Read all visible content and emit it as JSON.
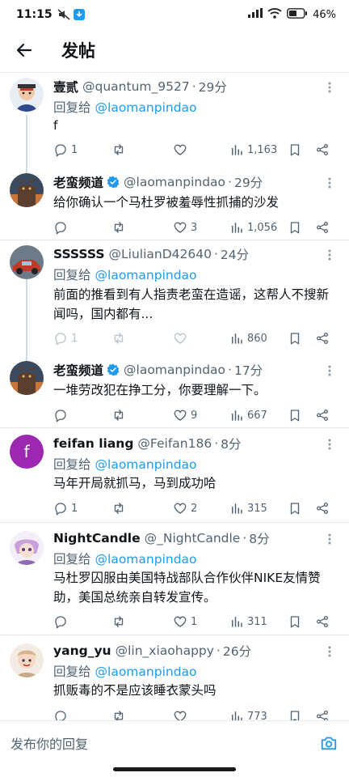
{
  "status_bar": {
    "time": "11:15",
    "battery": "46%"
  },
  "header": {
    "title": "发帖"
  },
  "posts": [
    {
      "name": "壹贰",
      "handle": "@quantum_9527",
      "time": "29分",
      "reply_prefix": "回复给",
      "reply_to": "@laomanpindao",
      "text": "f",
      "replies": "1",
      "retweets": "",
      "likes": "",
      "views": "1,163",
      "avatar_color": "#c9d6e8"
    },
    {
      "name": "老蛮频道",
      "verified": true,
      "handle": "@laomanpindao",
      "time": "29分",
      "text": "给你确认一个马杜罗被羞辱性抓捕的沙发",
      "replies": "",
      "retweets": "",
      "likes": "3",
      "views": "1,056",
      "avatar_color": "#7a5b48"
    },
    {
      "name": "SSSSSS",
      "handle": "@LiulianD42640",
      "time": "24分",
      "reply_prefix": "回复给",
      "reply_to": "@laomanpindao",
      "text": "前面的推看到有人指责老蛮在造谣，这帮人不搜新闻吗，国内都有...",
      "replies": "1",
      "retweets": "",
      "likes": "",
      "views": "860",
      "avatar_color": "#9aa8b4"
    },
    {
      "name": "老蛮频道",
      "verified": true,
      "handle": "@laomanpindao",
      "time": "17分",
      "text": "一堆劳改犯在挣工分，你要理解一下。",
      "replies": "",
      "retweets": "",
      "likes": "9",
      "views": "667",
      "avatar_color": "#7a5b48"
    },
    {
      "name": "feifan liang",
      "handle": "@Feifan186",
      "time": "8分",
      "reply_prefix": "回复给",
      "reply_to": "@laomanpindao",
      "text": "马年开局就抓马，马到成功哈",
      "replies": "1",
      "retweets": "",
      "likes": "2",
      "views": "315",
      "avatar_letter": "f",
      "avatar_color": "#9c27b0"
    },
    {
      "name": "NightCandle",
      "handle": "@_NightCandle",
      "time": "8分",
      "reply_prefix": "回复给",
      "reply_to": "@laomanpindao",
      "text": "马杜罗囚服由美国特战部队合作伙伴NIKE友情赞助，美国总统亲自转发宣传。",
      "replies": "",
      "retweets": "",
      "likes": "1",
      "views": "311",
      "avatar_color": "#d8c6e8"
    },
    {
      "name": "yang_yu",
      "handle": "@lin_xiaohappy",
      "time": "26分",
      "reply_prefix": "回复给",
      "reply_to": "@laomanpindao",
      "text": "抓贩毒的不是应该睡衣蒙头吗",
      "replies": "",
      "retweets": "",
      "likes": "",
      "views": "773",
      "avatar_color": "#e8d8c8"
    }
  ],
  "composer": {
    "placeholder": "发布你的回复"
  },
  "colors": {
    "accent": "#1d9bf0",
    "secondary_text": "#536471",
    "divider": "#e6e9eb"
  },
  "icons": {
    "back": "arrow-left-icon",
    "verified": "verified-badge-icon",
    "more": "more-vertical-icon",
    "reply": "reply-icon",
    "retweet": "retweet-icon",
    "like": "heart-icon",
    "views": "views-icon",
    "bookmark": "bookmark-icon",
    "share": "share-icon",
    "camera": "camera-icon"
  }
}
